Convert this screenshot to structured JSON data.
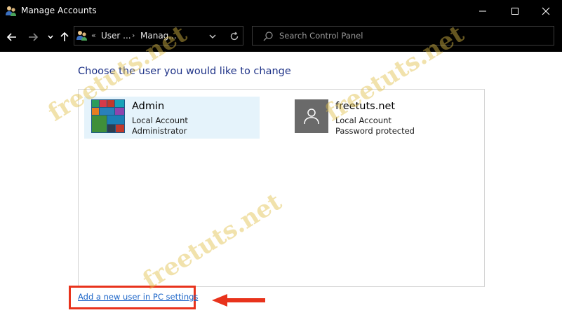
{
  "window": {
    "title": "Manage Accounts"
  },
  "address_bar": {
    "prefix": "«",
    "crumbs": [
      "User ...",
      "Manag..."
    ],
    "separator": "›"
  },
  "search": {
    "placeholder": "Search Control Panel"
  },
  "main": {
    "heading": "Choose the user you would like to change",
    "accounts": [
      {
        "name": "Admin",
        "type": "Local Account",
        "detail": "Administrator",
        "selected": true
      },
      {
        "name": "freetuts.net",
        "type": "Local Account",
        "detail": "Password protected",
        "selected": false
      }
    ],
    "add_user_link": "Add a new user in PC settings"
  },
  "watermark": {
    "text": "freetuts.net"
  },
  "colors": {
    "titlebar": "#000000",
    "heading": "#1e3287",
    "selected_bg": "#e5f3fb",
    "link": "#1a64c8",
    "annotation": "#e8331c"
  },
  "icons": [
    "users-app-icon",
    "minimize-icon",
    "maximize-icon",
    "close-icon",
    "back-arrow-icon",
    "forward-arrow-icon",
    "chevron-down-icon",
    "up-arrow-icon",
    "refresh-icon",
    "search-icon",
    "user-avatar-icon",
    "red-arrow-icon"
  ]
}
